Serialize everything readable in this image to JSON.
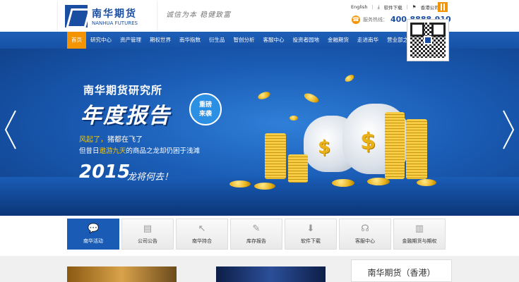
{
  "header": {
    "logo_cn": "南华期货",
    "logo_en": "NANHUA FUTURES",
    "slogan": "诚信为本  稳健致富",
    "links": [
      "English",
      "软件下载",
      "香港公司"
    ],
    "hotline_label": "服务热线：",
    "hotline_number": "400-8888-910"
  },
  "nav": {
    "items": [
      "首页",
      "研究中心",
      "资产管理",
      "期权世界",
      "南华指数",
      "衍生品",
      "智创分析",
      "客服中心",
      "投资者园地",
      "金融期货",
      "走进南华",
      "营业部之"
    ]
  },
  "banner": {
    "title": "南华期货研究所",
    "title2": "年度报告",
    "badge_line1": "重磅",
    "badge_line2": "来袭",
    "line1_a": "风起了，",
    "line1_b": "猪都在飞了",
    "line2_a": "但昔日",
    "line2_hl": "遨游九天",
    "line2_b": "的商品之龙却仍困于浅滩",
    "year": "2015",
    "year_text": "龙将何去！"
  },
  "tabs": [
    {
      "label": "南华活动",
      "icon": "chat-icon",
      "active": true
    },
    {
      "label": "公司公告",
      "icon": "document-icon",
      "active": false
    },
    {
      "label": "南华持合",
      "icon": "cursor-icon",
      "active": false
    },
    {
      "label": "库存报告",
      "icon": "pencil-icon",
      "active": false
    },
    {
      "label": "软件下载",
      "icon": "download-icon",
      "active": false
    },
    {
      "label": "客服中心",
      "icon": "headset-icon",
      "active": false
    },
    {
      "label": "金融期货与期权",
      "icon": "bar-chart-icon",
      "active": false
    }
  ],
  "side_box": {
    "title": "南华期货（香港）"
  },
  "colors": {
    "brand_blue": "#1a5cb5",
    "accent_orange": "#f39400"
  }
}
